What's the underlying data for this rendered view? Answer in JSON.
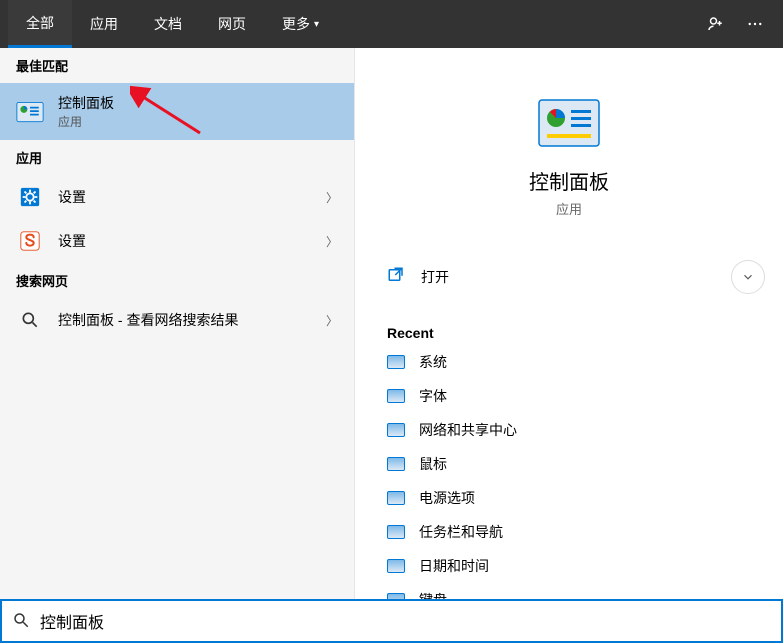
{
  "tabs": {
    "all": "全部",
    "apps": "应用",
    "docs": "文档",
    "web": "网页",
    "more": "更多"
  },
  "left": {
    "best_match_header": "最佳匹配",
    "best_match": {
      "title": "控制面板",
      "subtitle": "应用"
    },
    "apps_header": "应用",
    "app_items": [
      {
        "label": "设置"
      },
      {
        "label": "设置"
      }
    ],
    "search_web_header": "搜索网页",
    "web_item": {
      "prefix": "控制面板",
      "suffix": " - 查看网络搜索结果"
    }
  },
  "right": {
    "title": "控制面板",
    "subtitle": "应用",
    "open_label": "打开",
    "recent_header": "Recent",
    "recent": [
      "系统",
      "字体",
      "网络和共享中心",
      "鼠标",
      "电源选项",
      "任务栏和导航",
      "日期和时间",
      "键盘"
    ]
  },
  "search": {
    "value": "控制面板"
  }
}
